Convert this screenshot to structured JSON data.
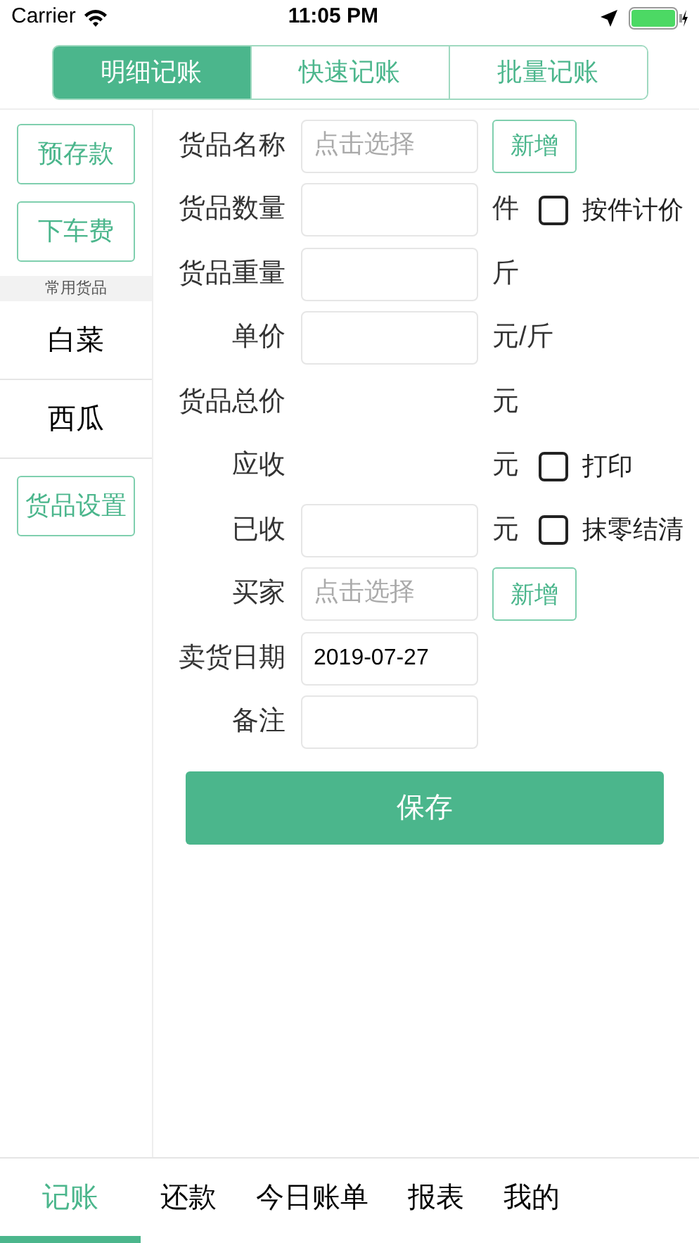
{
  "status_bar": {
    "carrier": "Carrier",
    "time": "11:05 PM"
  },
  "segments": [
    {
      "label": "明细记账",
      "selected": true
    },
    {
      "label": "快速记账",
      "selected": false
    },
    {
      "label": "批量记账",
      "selected": false
    }
  ],
  "sidebar": {
    "top_buttons": [
      "预存款",
      "下车费"
    ],
    "section_title": "常用货品",
    "items": [
      "白菜",
      "西瓜"
    ],
    "bottom_button": "货品设置"
  },
  "form": {
    "rows": [
      {
        "kind": "input",
        "label": "货品名称",
        "placeholder": "点击选择",
        "button": "新增"
      },
      {
        "kind": "input",
        "label": "货品数量",
        "unit": "件",
        "checkbox": {
          "label": "按件计价",
          "checked": false
        }
      },
      {
        "kind": "input",
        "label": "货品重量",
        "unit": "斤"
      },
      {
        "kind": "input",
        "label": "单价",
        "unit": "元/斤"
      },
      {
        "kind": "text",
        "label": "货品总价",
        "unit": "元"
      },
      {
        "kind": "text",
        "label": "应收",
        "unit": "元",
        "checkbox": {
          "label": "打印",
          "checked": false
        }
      },
      {
        "kind": "input",
        "label": "已收",
        "unit": "元",
        "checkbox": {
          "label": "抹零结清",
          "checked": false
        }
      },
      {
        "kind": "input",
        "label": "买家",
        "placeholder": "点击选择",
        "button": "新增"
      },
      {
        "kind": "input",
        "label": "卖货日期",
        "value": "2019-07-27"
      },
      {
        "kind": "input",
        "label": "备注"
      }
    ]
  },
  "save_button": "保存",
  "tab_bar": [
    {
      "label": "记账",
      "selected": true
    },
    {
      "label": "还款",
      "selected": false
    },
    {
      "label": "今日账单",
      "selected": false
    },
    {
      "label": "报表",
      "selected": false
    },
    {
      "label": "我的",
      "selected": false
    }
  ]
}
